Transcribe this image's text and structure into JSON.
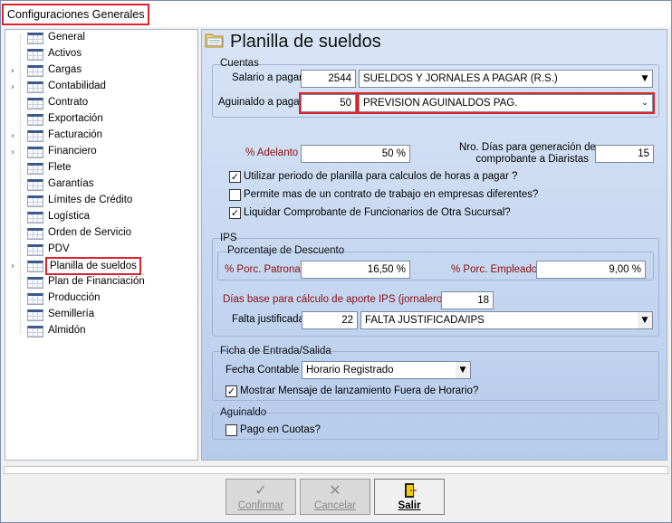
{
  "window": {
    "title": "Configuraciones Generales"
  },
  "tree": {
    "items": [
      {
        "label": "General",
        "expandable": false
      },
      {
        "label": "Activos",
        "expandable": false
      },
      {
        "label": "Cargas",
        "expandable": true
      },
      {
        "label": "Contabilidad",
        "expandable": true
      },
      {
        "label": "Contrato",
        "expandable": false
      },
      {
        "label": "Exportación",
        "expandable": false
      },
      {
        "label": "Facturación",
        "expandable": true
      },
      {
        "label": "Financiero",
        "expandable": true
      },
      {
        "label": "Flete",
        "expandable": false
      },
      {
        "label": "Garantías",
        "expandable": false
      },
      {
        "label": "Límites de Crédito",
        "expandable": false
      },
      {
        "label": "Logística",
        "expandable": false
      },
      {
        "label": "Orden de Servicio",
        "expandable": false
      },
      {
        "label": "PDV",
        "expandable": false
      },
      {
        "label": "Planilla de sueldos",
        "expandable": true,
        "selected": true
      },
      {
        "label": "Plan de Financiación",
        "expandable": false
      },
      {
        "label": "Producción",
        "expandable": false
      },
      {
        "label": "Semillería",
        "expandable": false
      },
      {
        "label": "Almidón",
        "expandable": false
      }
    ]
  },
  "main": {
    "title": "Planilla de sueldos",
    "icon": "folder-icon",
    "cuentas": {
      "group_label": "Cuentas",
      "salario_label": "Salario a pagar",
      "salario_code": "2544",
      "salario_desc": "SUELDOS Y JORNALES A PAGAR (R.S.)",
      "aguinaldo_label": "Aguinaldo a pagar",
      "aguinaldo_code": "50",
      "aguinaldo_desc": "PREVISION AGUINALDOS PAG."
    },
    "adelanto_label": "% Adelanto",
    "adelanto_value": "50 %",
    "dias_label_1": "Nro. Días para generación de",
    "dias_label_2": "comprobante a Diaristas",
    "dias_value": "15",
    "checks": [
      {
        "label": "Utilizar periodo de planilla para calculos de horas a pagar ?",
        "checked": true
      },
      {
        "label": "Permite mas de un contrato de trabajo en empresas diferentes?",
        "checked": false
      },
      {
        "label": "Liquidar Comprobante de Funcionarios de Otra Sucursal?",
        "checked": true
      }
    ],
    "ips": {
      "group_label": "IPS",
      "descuento_label": "Porcentaje de Descuento",
      "patronal_label": "% Porc. Patronal",
      "patronal_value": "16,50 %",
      "empleado_label": "% Porc. Empleado",
      "empleado_value": "9,00 %",
      "dias_base_label": "Días base para cálculo de aporte IPS (jornaleros)",
      "dias_base_value": "18",
      "falta_label": "Falta justificada",
      "falta_code": "22",
      "falta_desc": "FALTA JUSTIFICADA/IPS"
    },
    "ficha": {
      "group_label": "Ficha de Entrada/Salida",
      "fecha_label": "Fecha Contable",
      "fecha_value": "Horario Registrado",
      "mostrar_label": "Mostrar Mensaje de lanzamiento Fuera de Horario?",
      "mostrar_checked": true
    },
    "aguinaldo": {
      "group_label": "Aguinaldo",
      "cuotas_label": "Pago en Cuotas?",
      "cuotas_checked": false
    }
  },
  "buttons": {
    "confirmar": "Confirmar",
    "cancelar": "Cancelar",
    "salir": "Salir"
  },
  "colors": {
    "highlight": "#d9232d",
    "panel": "#c4d6f0"
  }
}
